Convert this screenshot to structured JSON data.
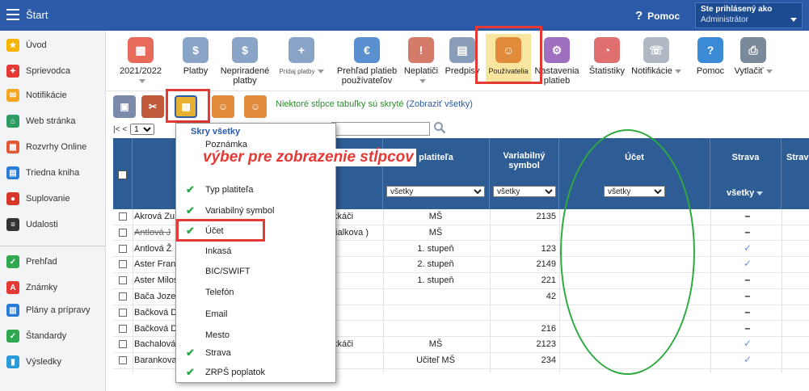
{
  "topbar": {
    "title": "Štart",
    "help": "Pomoc",
    "login_line1": "Ste prihlásený ako",
    "login_line2": "Administrátor"
  },
  "sidebar": {
    "items": [
      {
        "label": "Úvod",
        "color": "#f4b400",
        "icon": "star-icon"
      },
      {
        "label": "Sprievodca",
        "color": "#e53935",
        "icon": "magic-wand-icon"
      },
      {
        "label": "Notifikácie",
        "color": "#f4a623",
        "icon": "envelope-icon"
      },
      {
        "label": "Web stránka",
        "color": "#2e9b62",
        "icon": "home-icon"
      },
      {
        "label": "Rozvrhy Online",
        "color": "#e05a3a",
        "icon": "calendar-icon"
      },
      {
        "label": "Triedna kniha",
        "color": "#2a7bd6",
        "icon": "book-icon"
      },
      {
        "label": "Suplovanie",
        "color": "#d9362b",
        "icon": "person-icon"
      },
      {
        "label": "Udalosti",
        "color": "#333333",
        "icon": "list-icon"
      },
      {
        "label": "Prehľad",
        "color": "#2fa84f",
        "icon": "check-circle-icon"
      },
      {
        "label": "Známky",
        "color": "#e53935",
        "icon": "grade-icon"
      },
      {
        "label": "Plány a prípravy",
        "color": "#2a7bd6",
        "icon": "briefcase-icon"
      },
      {
        "label": "Štandardy",
        "color": "#2fa84f",
        "icon": "shield-icon"
      },
      {
        "label": "Výsledky",
        "color": "#2a9bd6",
        "icon": "bar-chart-icon"
      }
    ]
  },
  "ribbon": {
    "items": [
      {
        "label": "2021/2022",
        "icon": "calendar-icon",
        "color": "#e86a5a"
      },
      {
        "label": "Platby",
        "icon": "money-bag-icon",
        "color": "#8aa4c8"
      },
      {
        "label": "Nepriradené platby",
        "icon": "money-bag-icon",
        "color": "#8aa4c8"
      },
      {
        "label": "Pridaj platby",
        "icon": "money-bag-plus-icon",
        "color": "#8aa4c8"
      },
      {
        "label": "Prehľad platieb používateľov",
        "icon": "ledger-icon",
        "color": "#5a8fd0"
      },
      {
        "label": "Neplatiči",
        "icon": "money-bag-warning-icon",
        "color": "#d47b6a"
      },
      {
        "label": "Predpisy",
        "icon": "document-icon",
        "color": "#8a9db8"
      },
      {
        "label": "Používatelia",
        "icon": "user-icon",
        "color": "#e08a3a"
      },
      {
        "label": "Nastavenia platieb",
        "icon": "gear-icon",
        "color": "#a070c0"
      },
      {
        "label": "Štatistiky",
        "icon": "pie-chart-icon",
        "color": "#e07070"
      },
      {
        "label": "Notifikácie",
        "icon": "phone-icon",
        "color": "#b0b8c4"
      },
      {
        "label": "Pomoc",
        "icon": "question-icon",
        "color": "#3a8ad6"
      },
      {
        "label": "Vytlačiť",
        "icon": "printer-icon",
        "color": "#7a8a9a"
      }
    ]
  },
  "toolbar2": {
    "note": "Niektoré stĺpce tabuľky sú skryté",
    "show_all": "(Zobraziť všetky)"
  },
  "pager": {
    "prev": "|< <",
    "page": "1"
  },
  "table": {
    "headers": {
      "payer_type": "platiteľa",
      "vs": "Variabilný symbol",
      "account": "Účet",
      "strava": "Strava",
      "strava2": "Strav",
      "filter_all": "všetky",
      "strava_filter": "všetky"
    },
    "rows": [
      {
        "name": "Akrová Zu",
        "c1": "kkáči",
        "pt": "MŠ",
        "vs": "2135",
        "st": "–"
      },
      {
        "name": "Antlová J",
        "strike": true,
        "c1": "fialkova )",
        "pt": "MŠ",
        "vs": "",
        "st": "–"
      },
      {
        "name": "Antlová Ž",
        "c1": "",
        "pt": "1. stupeň",
        "vs": "123",
        "st": "✓"
      },
      {
        "name": "Aster Fran",
        "c1": "",
        "pt": "2. stupeň",
        "vs": "2149",
        "st": "✓"
      },
      {
        "name": "Aster Milos",
        "c1": "",
        "pt": "1. stupeň",
        "vs": "221",
        "st": "–"
      },
      {
        "name": "Bača Joze",
        "c1": "",
        "pt": "",
        "vs": "42",
        "st": "–"
      },
      {
        "name": "Bačková D",
        "c1": "'",
        "pt": "",
        "vs": "",
        "st": "–"
      },
      {
        "name": "Bačková D",
        "c1": "'",
        "pt": "",
        "vs": "216",
        "st": "–"
      },
      {
        "name": "Bachalová",
        "c1": "kkáči",
        "pt": "MŠ",
        "vs": "2123",
        "st": "✓"
      },
      {
        "name": "Barankova",
        "c1": "",
        "pt": "Učiteľ MŠ",
        "vs": "234",
        "st": "✓"
      }
    ]
  },
  "dropdown": {
    "header": "Skry všetky",
    "items": [
      {
        "label": "Poznámka",
        "checked": false
      },
      {
        "label": "Dátum narodenia",
        "checked": false
      },
      {
        "label": "Typ platiteľa",
        "checked": true
      },
      {
        "label": "Variabilný symbol",
        "checked": true
      },
      {
        "label": "Účet",
        "checked": true
      },
      {
        "label": "Inkasá",
        "checked": false
      },
      {
        "label": "BIC/SWIFT",
        "checked": false
      },
      {
        "label": "Telefón",
        "checked": false
      },
      {
        "label": "Email",
        "checked": false
      },
      {
        "label": "Mesto",
        "checked": false
      },
      {
        "label": "Strava",
        "checked": true
      },
      {
        "label": "ZRPŠ poplatok",
        "checked": true
      }
    ]
  },
  "annotation": {
    "text": "výber pre zobrazenie stĺpcov"
  }
}
